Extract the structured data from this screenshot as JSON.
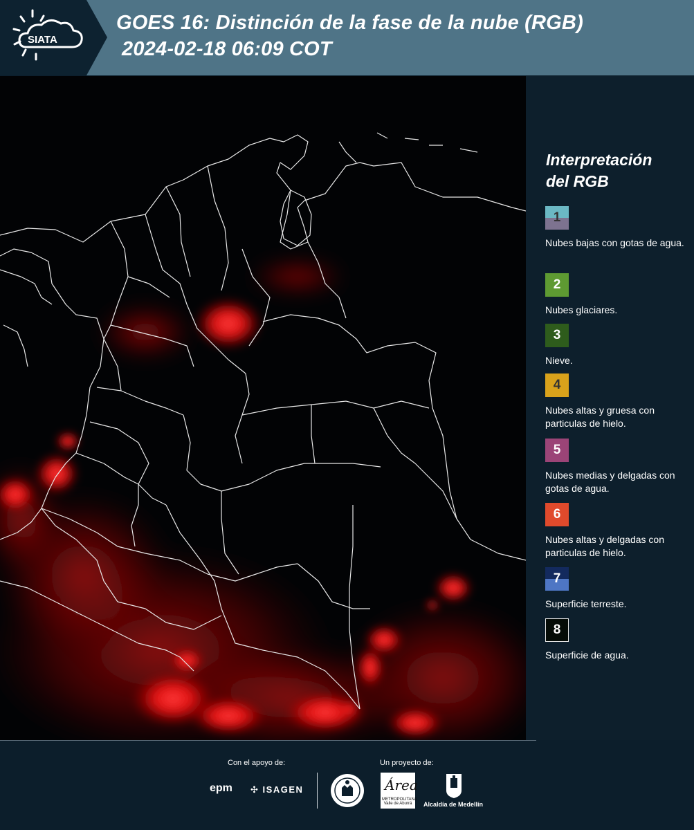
{
  "header": {
    "logo_text": "SIATA",
    "title_line1": "GOES 16: Distinción de la fase de la nube (RGB)",
    "title_line2": "2024-02-18 06:09 COT"
  },
  "legend": {
    "title_line1": "Interpretación",
    "title_line2": "del RGB",
    "items": [
      {
        "number": "1",
        "label": "Nubes bajas con gotas de agua.",
        "color_top": "#6bb8c4",
        "color_bottom": "#7d7390",
        "text_color": "#333333"
      },
      {
        "number": "2",
        "label": "Nubes glaciares.",
        "color_top": "#5e9a32",
        "color_bottom": "#5e9a32",
        "text_color": "#ffffff"
      },
      {
        "number": "3",
        "label": "Nieve.",
        "color_top": "#2e5c1c",
        "color_bottom": "#2e5c1c",
        "text_color": "#ffffff"
      },
      {
        "number": "4",
        "label": "Nubes altas y gruesa con particulas de hielo.",
        "color_top": "#d9a21b",
        "color_bottom": "#d9a21b",
        "text_color": "#333333"
      },
      {
        "number": "5",
        "label": "Nubes medias y delgadas con gotas de agua.",
        "color_top": "#9b4477",
        "color_bottom": "#9b4477",
        "text_color": "#ffffff"
      },
      {
        "number": "6",
        "label": "Nubes altas y delgadas con particulas de hielo.",
        "color_top": "#e04a2c",
        "color_bottom": "#e04a2c",
        "text_color": "#ffffff"
      },
      {
        "number": "7",
        "label": "Superficie terreste.",
        "color_top": "#132a5e",
        "color_bottom": "#4e76c4",
        "text_color": "#ffffff"
      },
      {
        "number": "8",
        "label": "Superficie de agua.",
        "color_top": "#050c07",
        "color_bottom": "#050c07",
        "text_color": "#ffffff"
      }
    ]
  },
  "footer": {
    "support_label": "Con el apoyo de:",
    "project_label": "Un proyecto de:",
    "epm_text": "epm",
    "isagen_text": "ISAGEN",
    "area_text": "Área",
    "area_sub": "METROPOLITANA Valle de Aburrá",
    "alcaldia_text": "Alcaldía de Medellín"
  },
  "colors": {
    "header_bg": "#4f7487",
    "panel_bg": "#0c1e2b",
    "map_bg": "#020305",
    "cloud_red": "#ff1a1a",
    "border_white": "#e8e8e8"
  }
}
